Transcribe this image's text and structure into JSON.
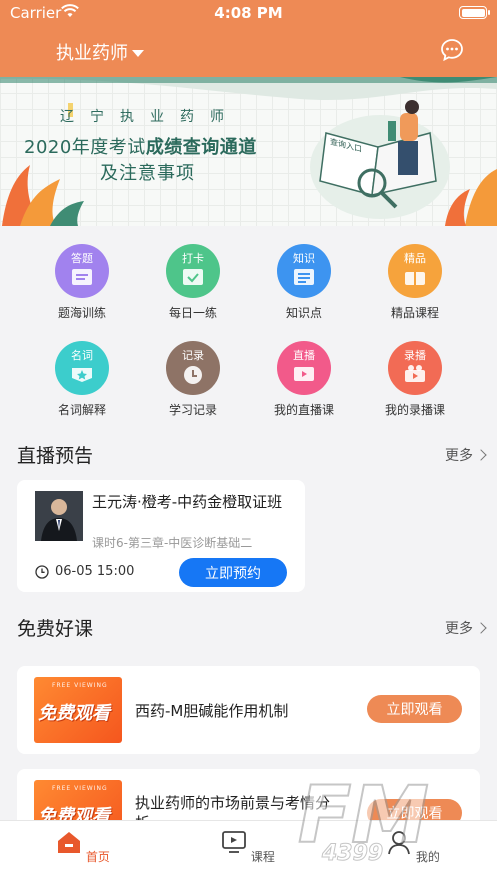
{
  "status_bar": {
    "carrier": "Carrier",
    "time": "4:08 PM"
  },
  "header": {
    "title": "执业药师",
    "message_icon": "chat-bubble-icon"
  },
  "banner": {
    "subtitle": "辽宁执业药师",
    "line1_prefix": "2020年度考试",
    "line1_bold": "成绩查询通道",
    "line2": "及注意事项",
    "badge": "查询入口"
  },
  "quick_entries": [
    {
      "tag": "答题",
      "label": "题海训练",
      "color": "#a182ee",
      "icon": "doc-icon"
    },
    {
      "tag": "打卡",
      "label": "每日一练",
      "color": "#4ec58a",
      "icon": "calendar-check-icon"
    },
    {
      "tag": "知识",
      "label": "知识点",
      "color": "#3d94f0",
      "icon": "book-icon"
    },
    {
      "tag": "精品",
      "label": "精品课程",
      "color": "#f6a33c",
      "icon": "gift-icon"
    },
    {
      "tag": "名词",
      "label": "名词解释",
      "color": "#3ccdcc",
      "icon": "star-card-icon"
    },
    {
      "tag": "记录",
      "label": "学习记录",
      "color": "#8e7366",
      "icon": "clock-icon"
    },
    {
      "tag": "直播",
      "label": "我的直播课",
      "color": "#f25a8a",
      "icon": "tv-icon"
    },
    {
      "tag": "录播",
      "label": "我的录播课",
      "color": "#f26b55",
      "icon": "video-icon"
    }
  ],
  "live_section": {
    "title": "直播预告",
    "more": "更多",
    "card": {
      "title": "王元涛·橙考-中药金橙取证班",
      "desc": "课时6-第三章-中医诊断基础二",
      "time": "06-05 15:00",
      "button": "立即预约"
    }
  },
  "free_section": {
    "title": "免费好课",
    "more": "更多",
    "courses": [
      {
        "thumb_en": "FREE VIEWING",
        "thumb_cn": "免费观看",
        "name": "西药-M胆碱能作用机制",
        "button": "立即观看"
      },
      {
        "thumb_en": "FREE VIEWING",
        "thumb_cn": "免费观看",
        "name": "执业药师的市场前景与考情分析",
        "button": "立即观看"
      }
    ]
  },
  "tabbar": {
    "items": [
      {
        "label": "首页",
        "icon": "home-icon",
        "active": true
      },
      {
        "label": "课程",
        "icon": "monitor-icon",
        "active": false
      },
      {
        "label": "我的",
        "icon": "user-icon",
        "active": false
      }
    ]
  },
  "watermark": {
    "text": "FM",
    "sub": "4399"
  },
  "colors": {
    "brand": "#ee8a55",
    "primary_button": "#1677f5",
    "active_tab": "#e8582c"
  }
}
